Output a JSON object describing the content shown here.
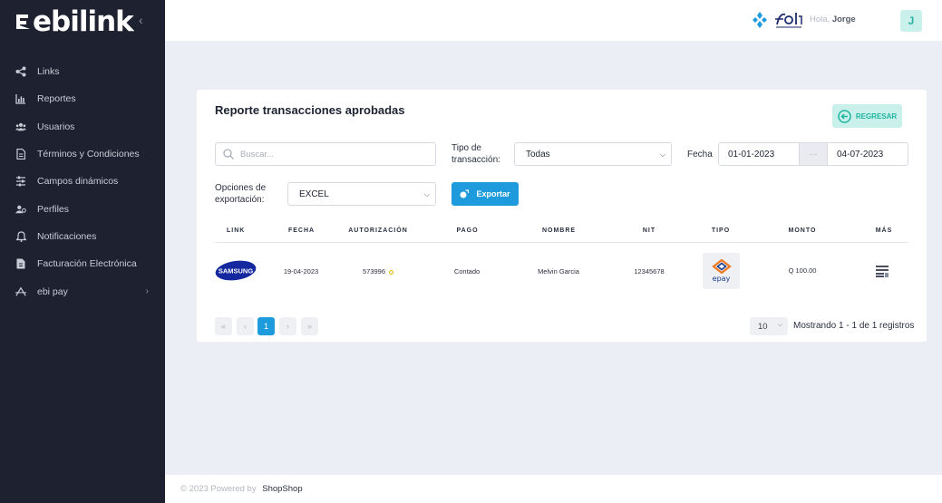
{
  "brand": {
    "logo_text": "ebilink",
    "collapse_icon": "chevron-left-icon"
  },
  "sidebar": {
    "items": [
      {
        "label": "Links",
        "icon": "share-icon"
      },
      {
        "label": "Reportes",
        "icon": "bar-chart-icon"
      },
      {
        "label": "Usuarios",
        "icon": "users-icon"
      },
      {
        "label": "Términos y Condiciones",
        "icon": "document-icon"
      },
      {
        "label": "Campos dinámicos",
        "icon": "sliders-icon"
      },
      {
        "label": "Perfiles",
        "icon": "profiles-icon"
      },
      {
        "label": "Notificaciones",
        "icon": "bell-icon"
      },
      {
        "label": "Facturación Electrónica",
        "icon": "invoice-icon"
      },
      {
        "label": "ebi pay",
        "icon": "ebipay-icon",
        "arrow": "›"
      }
    ]
  },
  "header": {
    "greeting": "Hola,",
    "user_name": "Jorge",
    "avatar_initial": "J"
  },
  "report": {
    "title": "Reporte transacciones aprobadas",
    "back_label": "REGRESAR",
    "search_placeholder": "Buscar...",
    "tipo_label_1": "Tipo de",
    "tipo_label_2": "transacción:",
    "tipo_value": "Todas",
    "fecha_label": "Fecha",
    "date_from": "01-01-2023",
    "date_sep": "···",
    "date_to": "04-07-2023",
    "export_label_1": "Opciones de",
    "export_label_2": "exportación:",
    "export_value": "EXCEL",
    "export_button": "Exportar"
  },
  "table": {
    "headers": [
      "LINK",
      "FECHA",
      "AUTORIZACIÓN",
      "PAGO",
      "NOMBRE",
      "NIT",
      "TIPO",
      "MONTO",
      "MÁS"
    ],
    "rows": [
      {
        "link": "SAMSUNG",
        "fecha": "19-04-2023",
        "autorizacion": "573996",
        "pago": "Contado",
        "nombre": "Melvin Garcia",
        "nit": "12345678",
        "tipo": "epay",
        "monto": "Q 100.00"
      }
    ]
  },
  "pagination": {
    "first": "«",
    "prev": "‹",
    "current": "1",
    "next": "›",
    "last": "»",
    "per_page": "10",
    "showing": "Mostrando 1 - 1 de 1 registros"
  },
  "footer": {
    "text": "© 2023 Powered by",
    "brand": "ShopShop"
  },
  "colors": {
    "sidebar": "#1e2230",
    "accent": "#1e9bdc",
    "teal": "#1fb59f",
    "background": "#eceef5"
  }
}
